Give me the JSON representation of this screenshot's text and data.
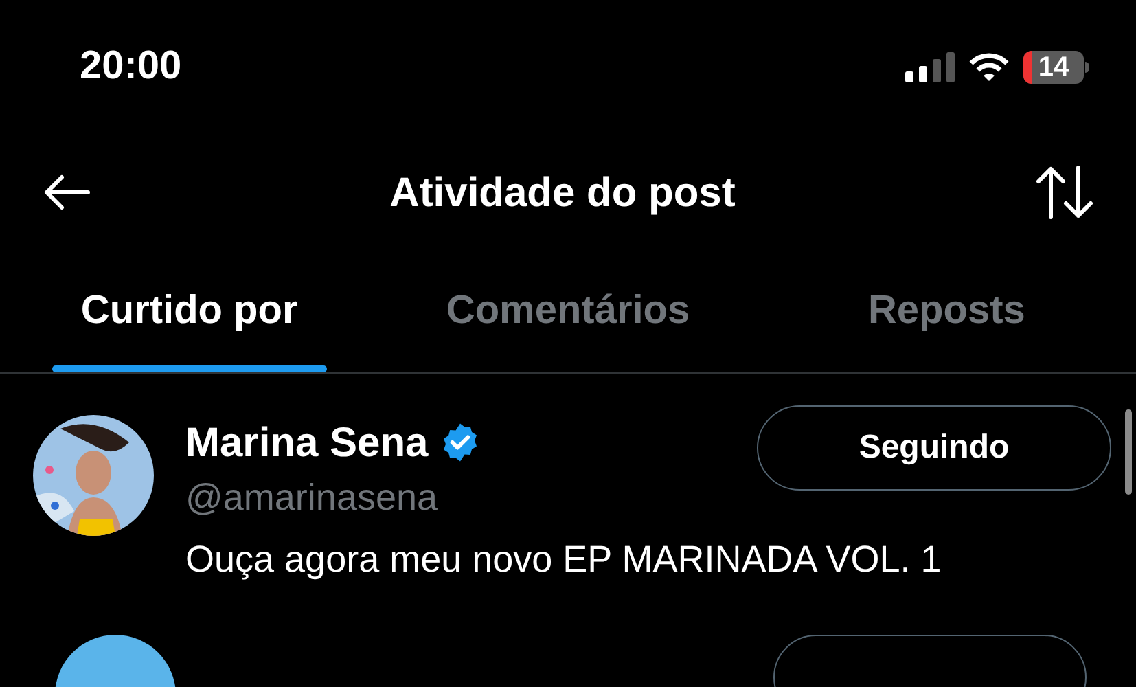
{
  "status_bar": {
    "time": "20:00",
    "battery": "14"
  },
  "header": {
    "title": "Atividade do post"
  },
  "tabs": [
    {
      "label": "Curtido por",
      "selected": true
    },
    {
      "label": "Comentários",
      "selected": false
    },
    {
      "label": "Reposts",
      "selected": false
    }
  ],
  "users": [
    {
      "name": "Marina Sena",
      "verified": true,
      "handle": "@amarinasena",
      "bio": "Ouça agora meu novo EP MARINADA VOL. 1",
      "button": "Seguindo",
      "following": true
    }
  ]
}
